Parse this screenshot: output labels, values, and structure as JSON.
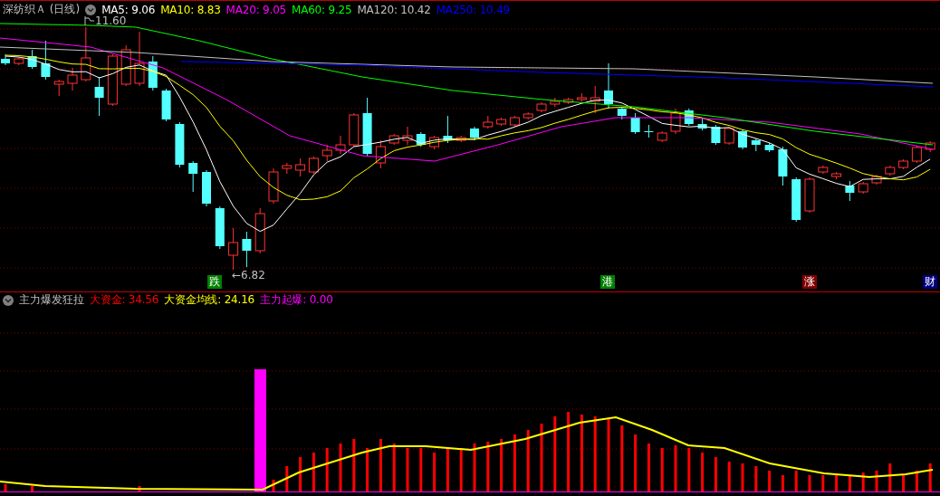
{
  "main_panel": {
    "title": "深纺织Ａ (日线)",
    "indicators": [
      {
        "label": "MA5: 9.06",
        "color": "#ffffff"
      },
      {
        "label": "MA10: 8.83",
        "color": "#ffff00"
      },
      {
        "label": "MA20: 9.05",
        "color": "#ff00ff"
      },
      {
        "label": "MA60: 9.25",
        "color": "#00ff00"
      },
      {
        "label": "MA120: 10.42",
        "color": "#c0c0c0"
      },
      {
        "label": "MA250: 10.49",
        "color": "#0000ff"
      }
    ],
    "annotations": [
      {
        "kind": "high",
        "text": "11.60"
      },
      {
        "kind": "low",
        "text": "←6.82"
      }
    ],
    "event_markers": [
      {
        "text": "跌",
        "color": "#008000"
      },
      {
        "text": "港",
        "color": "#008000"
      },
      {
        "text": "涨",
        "color": "#800000"
      },
      {
        "text": "财",
        "color": "#000080"
      }
    ]
  },
  "indicator_panel": {
    "title": "主力爆发狂拉",
    "values": [
      {
        "label": "大资金: 34.56",
        "color": "#ff0000"
      },
      {
        "label": "大资金均线: 24.16",
        "color": "#ffff00"
      },
      {
        "label": "主力起爆: 0.00",
        "color": "#ff00ff"
      }
    ]
  }
}
